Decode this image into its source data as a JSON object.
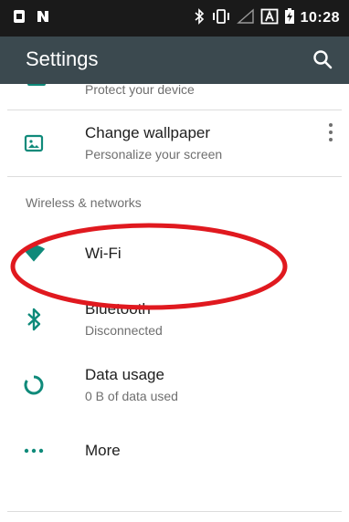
{
  "status_bar": {
    "time": "10:28",
    "icons": [
      "sim-icon",
      "nfc-icon",
      "bluetooth-icon",
      "vibrate-icon",
      "signal-icon",
      "a-badge-icon",
      "battery-icon"
    ]
  },
  "app_bar": {
    "title": "Settings",
    "search_icon": "search-icon"
  },
  "list": {
    "cut_item": {
      "subtitle": "Protect your device"
    },
    "wallpaper": {
      "title": "Change wallpaper",
      "subtitle": "Personalize your screen",
      "icon": "wallpaper-icon"
    },
    "section_header": "Wireless & networks",
    "items": [
      {
        "title": "Wi-Fi",
        "subtitle": "",
        "icon": "wifi-icon"
      },
      {
        "title": "Bluetooth",
        "subtitle": "Disconnected",
        "icon": "bluetooth-icon"
      },
      {
        "title": "Data usage",
        "subtitle": "0 B of data used",
        "icon": "data-usage-icon"
      },
      {
        "title": "More",
        "subtitle": "",
        "icon": "more-icon"
      }
    ]
  },
  "colors": {
    "status_bar": "#1a1a1a",
    "app_bar": "#3b494f",
    "accent": "#0f8a7a",
    "annotation": "#e0191f"
  }
}
